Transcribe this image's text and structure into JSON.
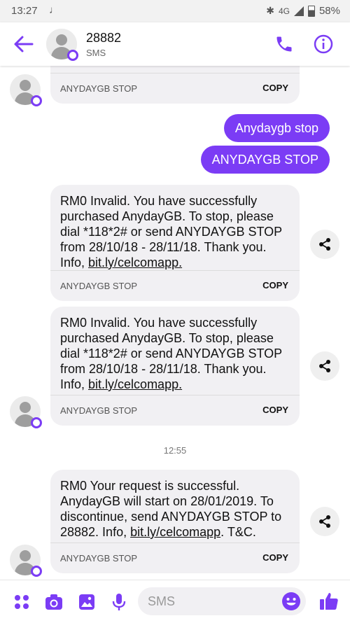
{
  "status_bar": {
    "time": "13:27",
    "network": "4G",
    "battery": "58%"
  },
  "header": {
    "title": "28882",
    "subtitle": "SMS"
  },
  "messages": [
    {
      "text_parts": [
        "RM0 Invalid. You have successfully purchased AnydayGB. To stop, please dial *118*2# or send ANYDAYGB STOP from 28/10/18 - 28/11/18. Thank you. Info, ",
        "bit.ly/celcomapp."
      ],
      "signature": "ANYDAYGB STOP",
      "copy": "COPY"
    },
    {
      "text_parts": [
        "RM0 Invalid. You have successfully purchased AnydayGB. To stop, please dial *118*2# or send ANYDAYGB STOP from 28/10/18 - 28/11/18. Thank you. Info, ",
        "bit.ly/celcomapp."
      ],
      "signature": "ANYDAYGB STOP",
      "copy": "COPY"
    },
    {
      "text_parts": [
        "RM0 Your request is successful. AnydayGB will start on 28/01/2019. To discontinue, send ANYDAYGB STOP to 28882. Info,  ",
        "bit.ly/celcomapp",
        ". T&C."
      ],
      "signature": "ANYDAYGB STOP",
      "copy": "COPY"
    }
  ],
  "top_partial": {
    "signature": "ANYDAYGB STOP",
    "copy": "COPY"
  },
  "sent": [
    "Anydaygb stop",
    "ANYDAYGB STOP"
  ],
  "timestamp": "12:55",
  "composer": {
    "placeholder": "SMS"
  },
  "colors": {
    "accent": "#7b3cf5",
    "bubble": "#f1f0f3"
  },
  "icons": [
    "back-arrow-icon",
    "phone-icon",
    "info-icon",
    "share-icon",
    "apps-icon",
    "camera-icon",
    "gallery-icon",
    "mic-icon",
    "emoji-icon",
    "thumbs-up-icon"
  ]
}
